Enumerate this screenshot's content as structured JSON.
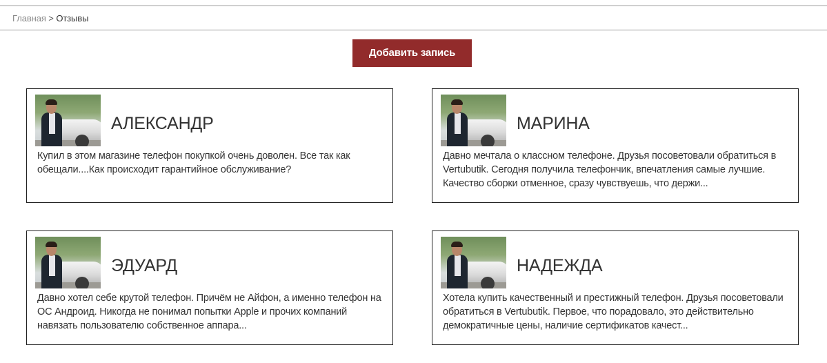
{
  "breadcrumb": {
    "home": "Главная",
    "separator": ">",
    "current": "Отзывы"
  },
  "add_button": {
    "label": "Добавить запись"
  },
  "colors": {
    "button_bg": "#922b2b",
    "border": "#222222",
    "divider": "#9a9a9a"
  },
  "reviews": [
    {
      "name": "АЛЕКСАНДР",
      "text": "Купил в этом магазине телефон покупкой очень доволен. Все так как обещали....Как происходит гарантийное обслуживание?"
    },
    {
      "name": "МАРИНА",
      "text": "Давно мечтала о классном телефоне. Друзья посоветовали обратиться в Vertubutik. Сегодня получила телефончик, впечатления самые лучшие. Качество сборки отменное, сразу чувствуешь, что держи..."
    },
    {
      "name": "ЭДУАРД",
      "text": "Давно хотел себе крутой телефон. Причём не Айфон, а именно телефон на ОС Андроид. Никогда не понимал попытки Apple и прочих компаний навязать пользователю собственное аппара..."
    },
    {
      "name": "НАДЕЖДА",
      "text": "Хотела купить качественный и престижный телефон. Друзья посоветовали обратиться в Vertubutik. Первое, что порадовало, это действительно демократичные цены, наличие сертификатов качест..."
    }
  ]
}
